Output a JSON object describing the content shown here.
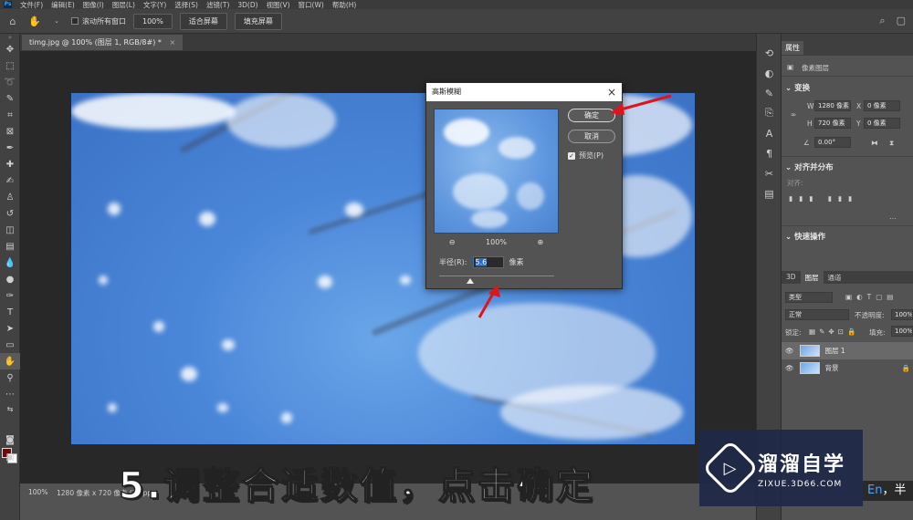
{
  "menu": [
    "文件(F)",
    "编辑(E)",
    "图像(I)",
    "图层(L)",
    "文字(Y)",
    "选择(S)",
    "滤镜(T)",
    "3D(D)",
    "视图(V)",
    "窗口(W)",
    "帮助(H)"
  ],
  "options": {
    "scroll_all_label": "滚动所有窗口",
    "zoom_btn": "100%",
    "fit_screen_btn": "适合屏幕",
    "fill_screen_btn": "填充屏幕"
  },
  "doc": {
    "tab_title": "timg.jpg @ 100% (图层 1, RGB/8#) *",
    "status_zoom": "100%",
    "status_dims": "1280 像素 x 720 像素 (72 ppi)"
  },
  "dialog": {
    "title": "高斯模糊",
    "ok_label": "确定",
    "cancel_label": "取消",
    "preview_label": "预览(P)",
    "zoom_value": "100%",
    "radius_label": "半径(R):",
    "radius_value": "5.6",
    "radius_unit": "像素"
  },
  "properties": {
    "tab": "属性",
    "layer_type": "像素图层",
    "transform_title": "变换",
    "w_label": "W",
    "w_value": "1280 像素",
    "h_label": "H",
    "h_value": "720 像素",
    "x_label": "X",
    "x_value": "0 像素",
    "y_label": "Y",
    "y_value": "0 像素",
    "angle_value": "0.00°",
    "align_title": "对齐并分布",
    "align_sub": "对齐:",
    "quick_title": "快速操作"
  },
  "layers": {
    "tabs": [
      "3D",
      "图层",
      "通道"
    ],
    "active_tab": "图层",
    "kind_label": "类型",
    "blend_mode": "正常",
    "opacity_label": "不透明度:",
    "opacity_value": "100%",
    "lock_label": "锁定:",
    "fill_label": "填充:",
    "fill_value": "100%",
    "items": [
      {
        "name": "图层 1",
        "selected": true
      },
      {
        "name": "背景",
        "selected": false
      }
    ]
  },
  "caption": "5.调整合适数值，点击确定",
  "watermark": {
    "title": "溜溜自学",
    "url": "ZIXUE.3D66.COM"
  },
  "ime": {
    "lang": "En",
    "extra": "，半"
  },
  "colors": {
    "foreground": "#6b0c0c",
    "background": "#ffffff",
    "arrow": "#e0141c"
  }
}
